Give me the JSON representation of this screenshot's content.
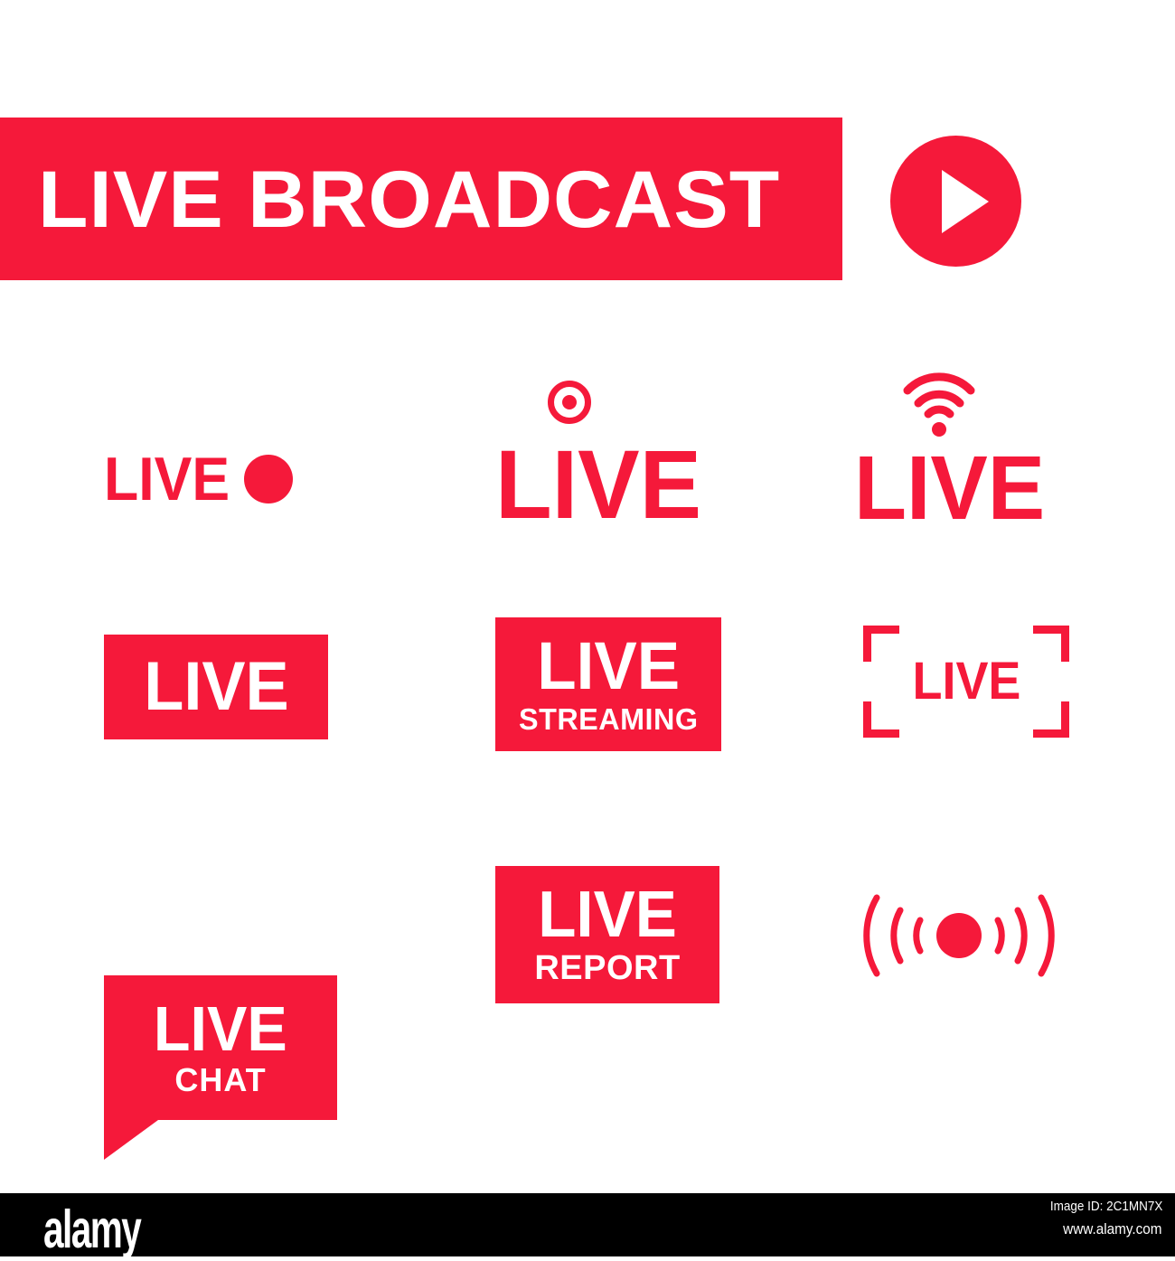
{
  "page": {
    "background": "#ffffff",
    "accent_red": "#F5193A",
    "white": "#ffffff"
  },
  "banner": {
    "title": "LIVE BROADCAST",
    "play_icon": "play-icon"
  },
  "badges": [
    {
      "id": "live-dot",
      "text": "LIVE",
      "style": "text-with-dot",
      "icon": "record-dot-icon",
      "color": "#F5193A"
    },
    {
      "id": "live-record",
      "text": "LIVE",
      "style": "text-with-record-ring",
      "icon": "record-ring-icon",
      "color": "#F5193A"
    },
    {
      "id": "live-wifi",
      "text": "LIVE",
      "style": "text-with-wifi",
      "icon": "wifi-signal-icon",
      "color": "#F5193A"
    },
    {
      "id": "live-box",
      "text": "LIVE",
      "style": "solid-box",
      "color": "#F5193A",
      "text_color": "#ffffff"
    },
    {
      "id": "live-streaming",
      "text": "LIVE",
      "subtext": "STREAMING",
      "style": "solid-box",
      "color": "#F5193A",
      "text_color": "#ffffff"
    },
    {
      "id": "live-frame",
      "text": "LIVE",
      "style": "corner-bracket-frame",
      "icon": "crop-frame-icon",
      "color": "#F5193A"
    },
    {
      "id": "live-chat",
      "text": "LIVE",
      "subtext": "CHAT",
      "style": "speech-bubble",
      "icon": "speech-bubble-icon",
      "color": "#F5193A",
      "text_color": "#ffffff"
    },
    {
      "id": "live-report",
      "text": "LIVE",
      "subtext": "REPORT",
      "style": "solid-box",
      "color": "#F5193A",
      "text_color": "#ffffff"
    },
    {
      "id": "live-waves",
      "text": "",
      "style": "broadcast-waves",
      "icon": "broadcast-signal-icon",
      "color": "#F5193A"
    }
  ],
  "watermark": {
    "logo": "alamy",
    "image_id": "Image ID: 2C1MN7X",
    "url": "www.alamy.com",
    "background": "#000000"
  }
}
